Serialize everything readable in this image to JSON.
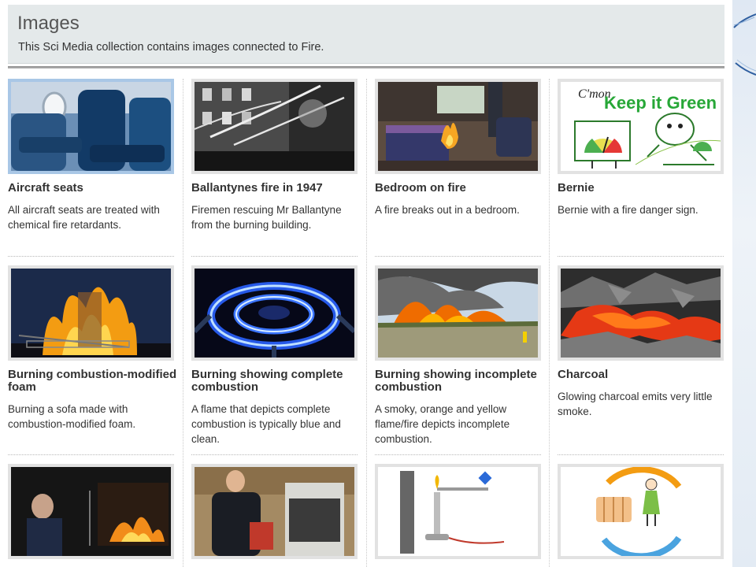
{
  "page": {
    "title": "Images",
    "subtitle": "This Sci Media collection contains images connected to Fire."
  },
  "cards": [
    {
      "title": "Aircraft seats",
      "desc": "All aircraft seats are treated with chemical fire retardants.",
      "thumb": "aircraft-seats-image"
    },
    {
      "title": "Ballantynes fire in 1947",
      "desc": "Firemen rescuing Mr Ballantyne from the burning building.",
      "thumb": "ballantynes-fire-image"
    },
    {
      "title": "Bedroom on fire",
      "desc": "A fire breaks out in a bedroom.",
      "thumb": "bedroom-fire-image"
    },
    {
      "title": "Bernie",
      "desc": "Bernie with a fire danger sign.",
      "thumb": "bernie-image",
      "logo_text": "C'mon Keep it Green"
    },
    {
      "title": "Burning combustion-modified foam",
      "desc": "Burning a sofa made with combustion-modified foam.",
      "thumb": "burning-foam-image"
    },
    {
      "title": "Burning showing complete combustion",
      "desc": "A flame that depicts complete combustion is typically blue and clean.",
      "thumb": "blue-flame-image"
    },
    {
      "title": "Burning showing incomplete combustion",
      "desc": "A smoky, orange and yellow flame/fire depicts incomplete combustion.",
      "thumb": "smoky-fire-image"
    },
    {
      "title": "Charcoal",
      "desc": "Glowing charcoal emits very little smoke.",
      "thumb": "charcoal-image"
    },
    {
      "title": "",
      "desc": "",
      "thumb": "lab-fire-test-image"
    },
    {
      "title": "",
      "desc": "",
      "thumb": "lab-scientist-image"
    },
    {
      "title": "",
      "desc": "",
      "thumb": "bunsen-burner-diagram"
    },
    {
      "title": "",
      "desc": "",
      "thumb": "heat-cycle-diagram"
    }
  ],
  "colors": {
    "header_bg": "#e4e9ea",
    "selected_border": "#a9c7e6",
    "thumb_border": "#e2e2e2"
  }
}
